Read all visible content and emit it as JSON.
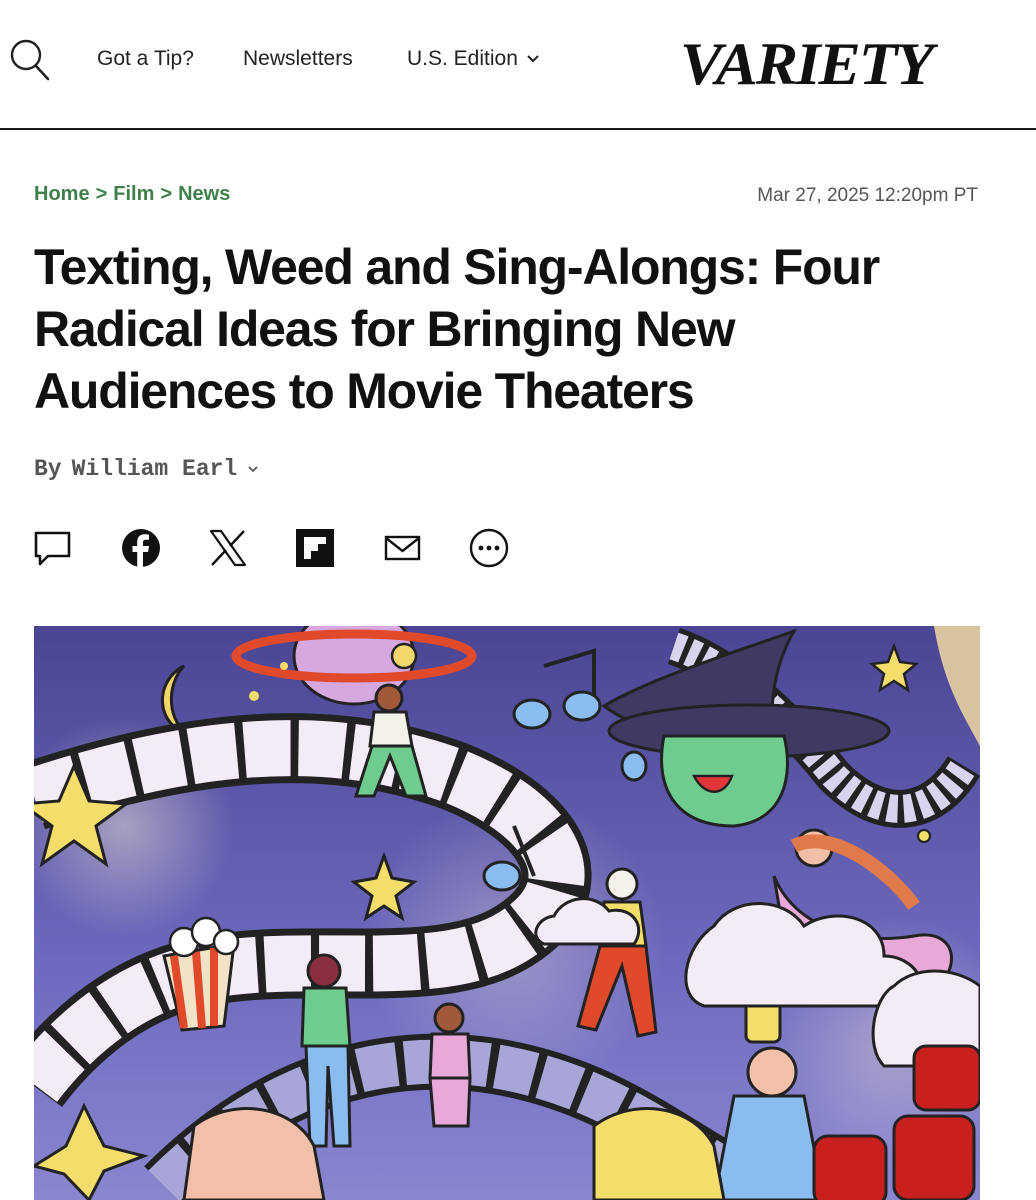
{
  "header": {
    "nav": {
      "tip": "Got a Tip?",
      "newsletters": "Newsletters",
      "edition": "U.S. Edition"
    },
    "logo_text": "VARIETY",
    "search_icon": "search-icon",
    "edition_icon": "chevron-down-icon"
  },
  "breadcrumb": {
    "items": [
      "Home",
      "Film",
      "News"
    ],
    "separator": ">"
  },
  "article": {
    "date": "Mar 27, 2025 12:20pm PT",
    "title_lines": [
      "Texting, Weed and Sing-Alongs: Four",
      "Radical Ideas for Bringing New",
      "Audiences to Movie Theaters"
    ],
    "byline_prefix": "By",
    "author": "William Earl"
  },
  "share": {
    "icons": [
      "comment-icon",
      "facebook-icon",
      "x-icon",
      "flipboard-icon",
      "email-icon",
      "more-icon"
    ]
  },
  "colors": {
    "breadcrumb_green": "#3e7f4b",
    "text": "#111111",
    "hero_purple": "#5b56a8"
  }
}
